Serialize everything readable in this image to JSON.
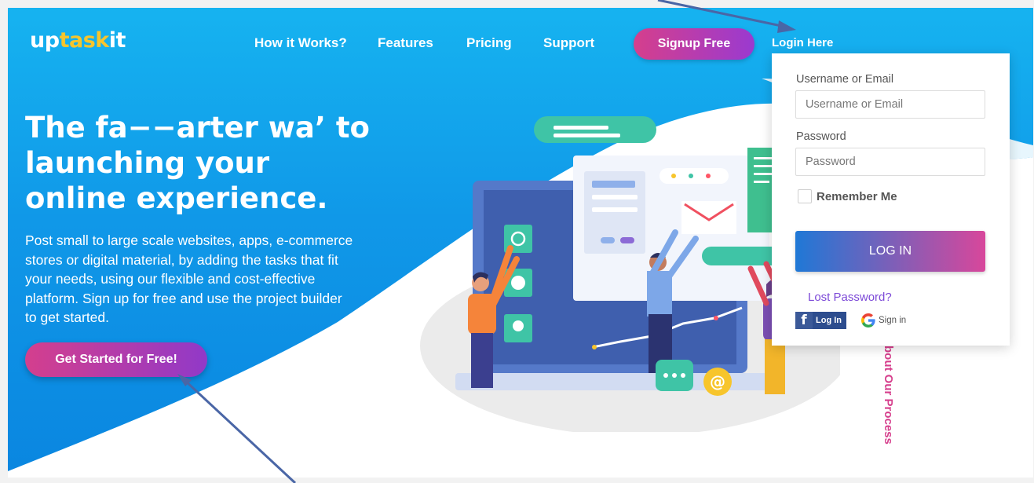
{
  "brand": {
    "logo_part1": "up",
    "logo_part2": "task",
    "logo_part3": "it"
  },
  "nav": {
    "items": [
      "How it Works?",
      "Features",
      "Pricing",
      "Support"
    ],
    "signup_label": "Signup Free",
    "login_label": "Login Here"
  },
  "hero": {
    "headline_line1": "The fa−−arter wa’ to",
    "headline_line2": "launching your",
    "headline_line3": "online experience.",
    "description": "Post small to large scale websites, apps, e-commerce stores or digital material, by adding the tasks that fit your needs, using our flexible and cost-effective platform. Sign up for free and use the project builder to get started.",
    "cta_label": "Get Started for Free!"
  },
  "side_label": "bout Our Process",
  "login_form": {
    "username_label": "Username or Email",
    "username_placeholder": "Username or Email",
    "password_label": "Password",
    "password_placeholder": "Password",
    "remember_label": "Remember Me",
    "submit_label": "LOG IN",
    "lost_password_label": "Lost Password?",
    "facebook_label": "Log In",
    "google_label": "Sign in"
  },
  "colors": {
    "hero_blue": "#1098e8",
    "accent_pink": "#d53f8c",
    "accent_purple": "#9a3ad0",
    "logo_yellow": "#f7c52c",
    "annotation_arrow": "#4a66a6"
  }
}
